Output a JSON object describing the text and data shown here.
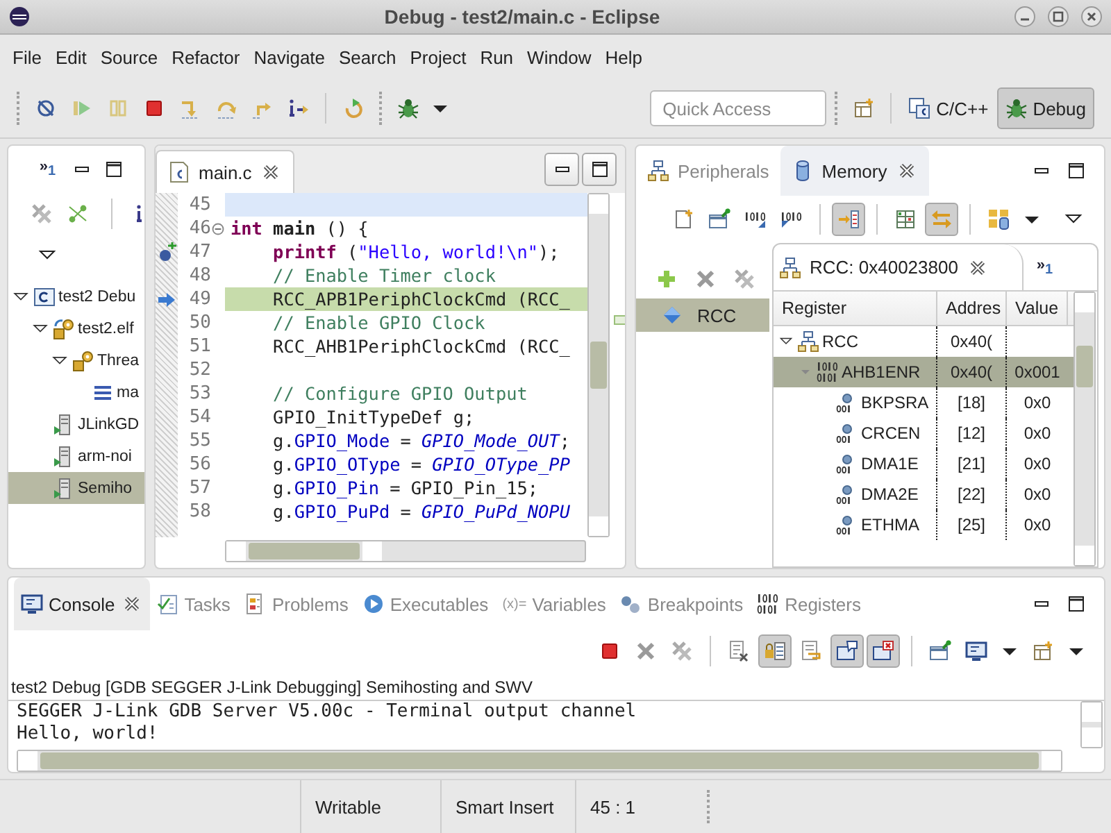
{
  "window": {
    "title": "Debug - test2/main.c - Eclipse"
  },
  "menu": [
    "File",
    "Edit",
    "Source",
    "Refactor",
    "Navigate",
    "Search",
    "Project",
    "Run",
    "Window",
    "Help"
  ],
  "toolbar": {
    "quick_access": {
      "placeholder": "Quick Access"
    },
    "perspectives": [
      {
        "label": "C/C++",
        "selected": false
      },
      {
        "label": "Debug",
        "selected": true
      }
    ]
  },
  "debug_view": {
    "overflow": "»$_{1}$",
    "tree": [
      {
        "label": "test2 Debu",
        "kind": "launch",
        "expanded": true,
        "selected": false,
        "children": [
          {
            "label": "test2.elf",
            "kind": "program",
            "expanded": true,
            "selected": false,
            "children": [
              {
                "label": "Threa",
                "kind": "thread",
                "expanded": true,
                "selected": false,
                "children": [
                  {
                    "label": "ma",
                    "kind": "frame",
                    "selected": false
                  }
                ]
              }
            ]
          },
          {
            "label": "JLinkGD",
            "kind": "process",
            "selected": false
          },
          {
            "label": "arm-noi",
            "kind": "process",
            "selected": false
          },
          {
            "label": "Semiho",
            "kind": "process",
            "selected": true
          }
        ]
      }
    ]
  },
  "editor": {
    "tab": {
      "label": "main.c"
    },
    "lines": [
      {
        "number": "45",
        "current_line": true,
        "executing": false,
        "foldable": false,
        "breakpoint": false,
        "instruction_pointer": false
      },
      {
        "number": "46",
        "current_line": false,
        "executing": false,
        "foldable": true,
        "breakpoint": false,
        "instruction_pointer": false,
        "tokens": [
          {
            "kind": "keyword",
            "text": "int"
          },
          {
            "kind": "function",
            "text": " main"
          },
          {
            "kind": "plain",
            "text": " () {"
          }
        ]
      },
      {
        "number": "47",
        "current_line": false,
        "executing": false,
        "foldable": false,
        "breakpoint": true,
        "instruction_pointer": false,
        "tokens": [
          {
            "kind": "macro",
            "text": "    printf"
          },
          {
            "kind": "plain",
            "text": " ("
          },
          {
            "kind": "string",
            "text": "\"Hello, world!\\n\""
          },
          {
            "kind": "plain",
            "text": ");"
          }
        ]
      },
      {
        "number": "48",
        "current_line": false,
        "executing": false,
        "foldable": false,
        "breakpoint": false,
        "instruction_pointer": false,
        "tokens": [
          {
            "kind": "comment",
            "text": "    // Enable Timer clock"
          }
        ]
      },
      {
        "number": "49",
        "current_line": false,
        "executing": true,
        "foldable": false,
        "breakpoint": false,
        "instruction_pointer": true,
        "tokens": [
          {
            "kind": "plain",
            "text": "    RCC_APB1PeriphClockCmd (RCC_"
          }
        ]
      },
      {
        "number": "50",
        "current_line": false,
        "executing": false,
        "foldable": false,
        "breakpoint": false,
        "instruction_pointer": false,
        "tokens": [
          {
            "kind": "comment",
            "text": "    // Enable GPIO Clock"
          }
        ]
      },
      {
        "number": "51",
        "current_line": false,
        "executing": false,
        "foldable": false,
        "breakpoint": false,
        "instruction_pointer": false,
        "tokens": [
          {
            "kind": "plain",
            "text": "    RCC_AHB1PeriphClockCmd (RCC_"
          }
        ]
      },
      {
        "number": "52",
        "current_line": false,
        "executing": false,
        "foldable": false,
        "breakpoint": false,
        "instruction_pointer": false
      },
      {
        "number": "53",
        "current_line": false,
        "executing": false,
        "foldable": false,
        "breakpoint": false,
        "instruction_pointer": false,
        "tokens": [
          {
            "kind": "comment",
            "text": "    // Configure GPIO Output"
          }
        ]
      },
      {
        "number": "54",
        "current_line": false,
        "executing": false,
        "foldable": false,
        "breakpoint": false,
        "instruction_pointer": false,
        "tokens": [
          {
            "kind": "plain",
            "text": "    GPIO_InitTypeDef g;"
          }
        ]
      },
      {
        "number": "55",
        "current_line": false,
        "executing": false,
        "foldable": false,
        "breakpoint": false,
        "instruction_pointer": false,
        "tokens": [
          {
            "kind": "plain",
            "text": "    g."
          },
          {
            "kind": "field",
            "text": "GPIO_Mode"
          },
          {
            "kind": "plain",
            "text": " = "
          },
          {
            "kind": "constant",
            "text": "GPIO_Mode_OUT"
          },
          {
            "kind": "plain",
            "text": ";"
          }
        ]
      },
      {
        "number": "56",
        "current_line": false,
        "executing": false,
        "foldable": false,
        "breakpoint": false,
        "instruction_pointer": false,
        "tokens": [
          {
            "kind": "plain",
            "text": "    g."
          },
          {
            "kind": "field",
            "text": "GPIO_OType"
          },
          {
            "kind": "plain",
            "text": " = "
          },
          {
            "kind": "constant",
            "text": "GPIO_OType_PP"
          }
        ]
      },
      {
        "number": "57",
        "current_line": false,
        "executing": false,
        "foldable": false,
        "breakpoint": false,
        "instruction_pointer": false,
        "tokens": [
          {
            "kind": "plain",
            "text": "    g."
          },
          {
            "kind": "field",
            "text": "GPIO_Pin"
          },
          {
            "kind": "plain",
            "text": " = GPIO_Pin_15;"
          }
        ]
      },
      {
        "number": "58",
        "current_line": false,
        "executing": false,
        "foldable": false,
        "breakpoint": false,
        "instruction_pointer": false,
        "tokens": [
          {
            "kind": "plain",
            "text": "    g."
          },
          {
            "kind": "field",
            "text": "GPIO_PuPd"
          },
          {
            "kind": "plain",
            "text": " = "
          },
          {
            "kind": "constant",
            "text": "GPIO_PuPd_NOPU"
          }
        ]
      }
    ]
  },
  "memory_view": {
    "tabs": [
      {
        "label": "Peripherals",
        "selected": false
      },
      {
        "label": "Memory",
        "selected": true
      }
    ],
    "toolbar": [
      {
        "pressed": false
      },
      {
        "pressed": false
      },
      {
        "pressed": false
      },
      {
        "pressed": false
      },
      {
        "pressed": true
      },
      {
        "pressed": false
      },
      {
        "pressed": true
      },
      {
        "pressed": false
      }
    ],
    "monitors": [
      {
        "label": "RCC",
        "selected": true
      }
    ],
    "rendering": {
      "tab": "RCC: 0x40023800",
      "overflow": "»$_{1}$",
      "columns": [
        "Register",
        "Addres",
        "Value"
      ],
      "rows": [
        {
          "register": "RCC",
          "address": "0x40(",
          "kind": "peripheral",
          "expanded": true,
          "selected": false,
          "children": [
            {
              "register": "AHB1ENR",
              "address": "0x40(",
              "value": "0x001",
              "kind": "register",
              "expanded": true,
              "selected": true,
              "children": [
                {
                  "register": "BKPSRA",
                  "address": "[18]",
                  "value": "0x0",
                  "kind": "field",
                  "selected": false
                },
                {
                  "register": "CRCEN",
                  "address": "[12]",
                  "value": "0x0",
                  "kind": "field",
                  "selected": false
                },
                {
                  "register": "DMA1E",
                  "address": "[21]",
                  "value": "0x0",
                  "kind": "field",
                  "selected": false
                },
                {
                  "register": "DMA2E",
                  "address": "[22]",
                  "value": "0x0",
                  "kind": "field",
                  "selected": false
                },
                {
                  "register": "ETHMA",
                  "address": "[25]",
                  "value": "0x0",
                  "kind": "field",
                  "selected": false
                }
              ]
            }
          ]
        }
      ]
    }
  },
  "console_view": {
    "tabs": [
      {
        "label": "Console",
        "selected": true
      },
      {
        "label": "Tasks",
        "selected": false
      },
      {
        "label": "Problems",
        "selected": false
      },
      {
        "label": "Executables",
        "selected": false
      },
      {
        "label": "Variables",
        "selected": false,
        "glyph": "(x)="
      },
      {
        "label": "Breakpoints",
        "selected": false
      },
      {
        "label": "Registers",
        "selected": false
      }
    ],
    "toolbar": [
      {
        "pressed": false
      },
      {
        "pressed": false
      },
      {
        "pressed": false
      },
      {
        "pressed": false
      },
      {
        "pressed": true
      },
      {
        "pressed": false
      },
      {
        "pressed": true
      },
      {
        "pressed": true
      },
      {
        "pressed": false
      },
      {
        "pressed": false
      },
      {
        "pressed": false
      }
    ],
    "launch": "test2 Debug [GDB SEGGER J-Link Debugging] Semihosting and SWV",
    "output": [
      "SEGGER J-Link GDB Server V5.00c - Terminal output channel",
      "Hello, world!"
    ]
  },
  "status_bar": [
    "Writable",
    "Smart Insert",
    "45 : 1"
  ]
}
